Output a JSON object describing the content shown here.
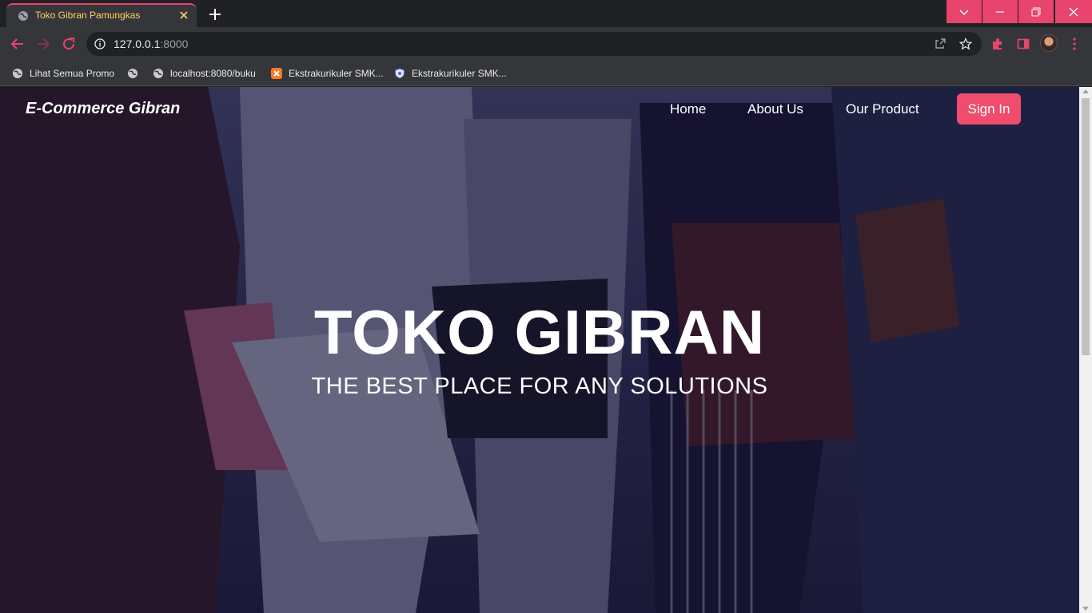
{
  "browser": {
    "tab_title": "Toko Gibran Pamungkas",
    "url_host": "127.0.0.1",
    "url_port": ":8000",
    "accent_color": "#e8446e",
    "bookmarks": [
      {
        "label": "Lihat Semua Promo",
        "icon": "globe-icon"
      },
      {
        "label": "",
        "icon": "globe-icon"
      },
      {
        "label": "localhost:8080/buku",
        "icon": "globe-icon"
      },
      {
        "label": "Ekstrakurikuler SMK...",
        "icon": "xampp-icon"
      },
      {
        "label": "Ekstrakurikuler SMK...",
        "icon": "school-crest-icon"
      }
    ]
  },
  "page": {
    "brand": "E-Commerce Gibran",
    "nav": {
      "home": "Home",
      "about": "About Us",
      "product": "Our Product",
      "signin": "Sign In"
    },
    "hero_title": "TOKO GIBRAN",
    "hero_subtitle": "THE BEST PLACE FOR ANY SOLUTIONS",
    "signin_color": "#f04d6d"
  }
}
